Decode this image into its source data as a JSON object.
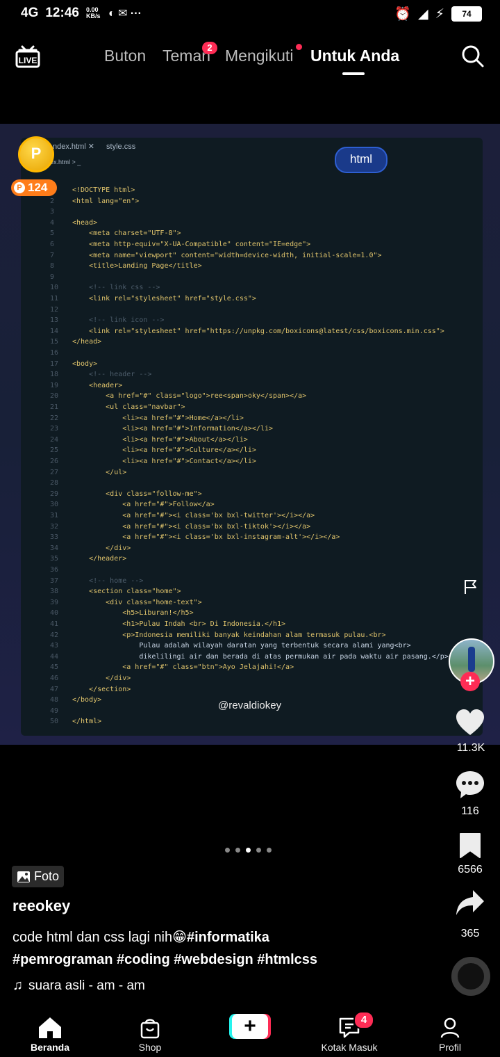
{
  "status_bar": {
    "network": "4G",
    "time": "12:46",
    "speed": "0.00 KB/s",
    "battery": "74"
  },
  "top_nav": {
    "tabs": [
      {
        "label": "Buton"
      },
      {
        "label": "Teman",
        "badge": "2"
      },
      {
        "label": "Mengikuti"
      },
      {
        "label": "Untuk Anda"
      }
    ],
    "live_label": "LIVE"
  },
  "coins": {
    "count": "124",
    "coin_letter": "P"
  },
  "post_image": {
    "editor_tabs": [
      "ndex.html",
      "style.css"
    ],
    "breadcrumb": "index.html > _",
    "tag_pill": "html",
    "watermark": "@revaldiokey",
    "lines": [
      {
        "n": "1",
        "t": "<!DOCTYPE html>"
      },
      {
        "n": "2",
        "t": "<html lang=\"en\">"
      },
      {
        "n": "3",
        "t": ""
      },
      {
        "n": "4",
        "t": "<head>"
      },
      {
        "n": "5",
        "t": "    <meta charset=\"UTF-8\">"
      },
      {
        "n": "6",
        "t": "    <meta http-equiv=\"X-UA-Compatible\" content=\"IE=edge\">"
      },
      {
        "n": "7",
        "t": "    <meta name=\"viewport\" content=\"width=device-width, initial-scale=1.0\">"
      },
      {
        "n": "8",
        "t": "    <title>Landing Page</title>"
      },
      {
        "n": "9",
        "t": ""
      },
      {
        "n": "10",
        "t": "    <!-- link css -->"
      },
      {
        "n": "11",
        "t": "    <link rel=\"stylesheet\" href=\"style.css\">"
      },
      {
        "n": "12",
        "t": ""
      },
      {
        "n": "13",
        "t": "    <!-- link icon -->"
      },
      {
        "n": "14",
        "t": "    <link rel=\"stylesheet\" href=\"https://unpkg.com/boxicons@latest/css/boxicons.min.css\">"
      },
      {
        "n": "15",
        "t": "</head>"
      },
      {
        "n": "16",
        "t": ""
      },
      {
        "n": "17",
        "t": "<body>"
      },
      {
        "n": "18",
        "t": "    <!-- header -->"
      },
      {
        "n": "19",
        "t": "    <header>"
      },
      {
        "n": "20",
        "t": "        <a href=\"#\" class=\"logo\">ree<span>oky</span></a>"
      },
      {
        "n": "21",
        "t": "        <ul class=\"navbar\">"
      },
      {
        "n": "22",
        "t": "            <li><a href=\"#\">Home</a></li>"
      },
      {
        "n": "23",
        "t": "            <li><a href=\"#\">Information</a></li>"
      },
      {
        "n": "24",
        "t": "            <li><a href=\"#\">About</a></li>"
      },
      {
        "n": "25",
        "t": "            <li><a href=\"#\">Culture</a></li>"
      },
      {
        "n": "26",
        "t": "            <li><a href=\"#\">Contact</a></li>"
      },
      {
        "n": "27",
        "t": "        </ul>"
      },
      {
        "n": "28",
        "t": ""
      },
      {
        "n": "29",
        "t": "        <div class=\"follow-me\">"
      },
      {
        "n": "30",
        "t": "            <a href=\"#\">Follow</a>"
      },
      {
        "n": "31",
        "t": "            <a href=\"#\"><i class='bx bxl-twitter'></i></a>"
      },
      {
        "n": "32",
        "t": "            <a href=\"#\"><i class='bx bxl-tiktok'></i></a>"
      },
      {
        "n": "33",
        "t": "            <a href=\"#\"><i class='bx bxl-instagram-alt'></i></a>"
      },
      {
        "n": "34",
        "t": "        </div>"
      },
      {
        "n": "35",
        "t": "    </header>"
      },
      {
        "n": "36",
        "t": ""
      },
      {
        "n": "37",
        "t": "    <!-- home -->"
      },
      {
        "n": "38",
        "t": "    <section class=\"home\">"
      },
      {
        "n": "39",
        "t": "        <div class=\"home-text\">"
      },
      {
        "n": "40",
        "t": "            <h5>Liburan!</h5>"
      },
      {
        "n": "41",
        "t": "            <h1>Pulau Indah <br> Di Indonesia.</h1>"
      },
      {
        "n": "42",
        "t": "            <p>Indonesia memiliki banyak keindahan alam termasuk pulau.<br>"
      },
      {
        "n": "43",
        "t": "                Pulau adalah wilayah daratan yang terbentuk secara alami yang<br>"
      },
      {
        "n": "44",
        "t": "                dikelilingi air dan berada di atas permukan air pada waktu air pasang.</p>"
      },
      {
        "n": "45",
        "t": "            <a href=\"#\" class=\"btn\">Ayo Jelajahi!</a>"
      },
      {
        "n": "46",
        "t": "        </div>"
      },
      {
        "n": "47",
        "t": "    </section>"
      },
      {
        "n": "48",
        "t": "</body>"
      },
      {
        "n": "49",
        "t": ""
      },
      {
        "n": "50",
        "t": "</html>"
      }
    ]
  },
  "right_rail": {
    "likes": "11.3K",
    "comments": "116",
    "saves": "6566",
    "shares": "365"
  },
  "post": {
    "type_label": "Foto",
    "username": "reeokey",
    "caption_text": "code html dan css lagi nih😁",
    "hashtags_line1": "#informatika",
    "hashtags_line2": "#pemrograman #coding #webdesign #htmlcss",
    "sound": "suara asli - am - am",
    "page_dots": 5,
    "active_dot": 3
  },
  "bottom_nav": {
    "home": "Beranda",
    "shop": "Shop",
    "inbox": "Kotak Masuk",
    "inbox_badge": "4",
    "profile": "Profil"
  },
  "colors": {
    "accent": "#fe2c55",
    "cyan": "#25f4ee",
    "coin": "#ff7d1a"
  }
}
